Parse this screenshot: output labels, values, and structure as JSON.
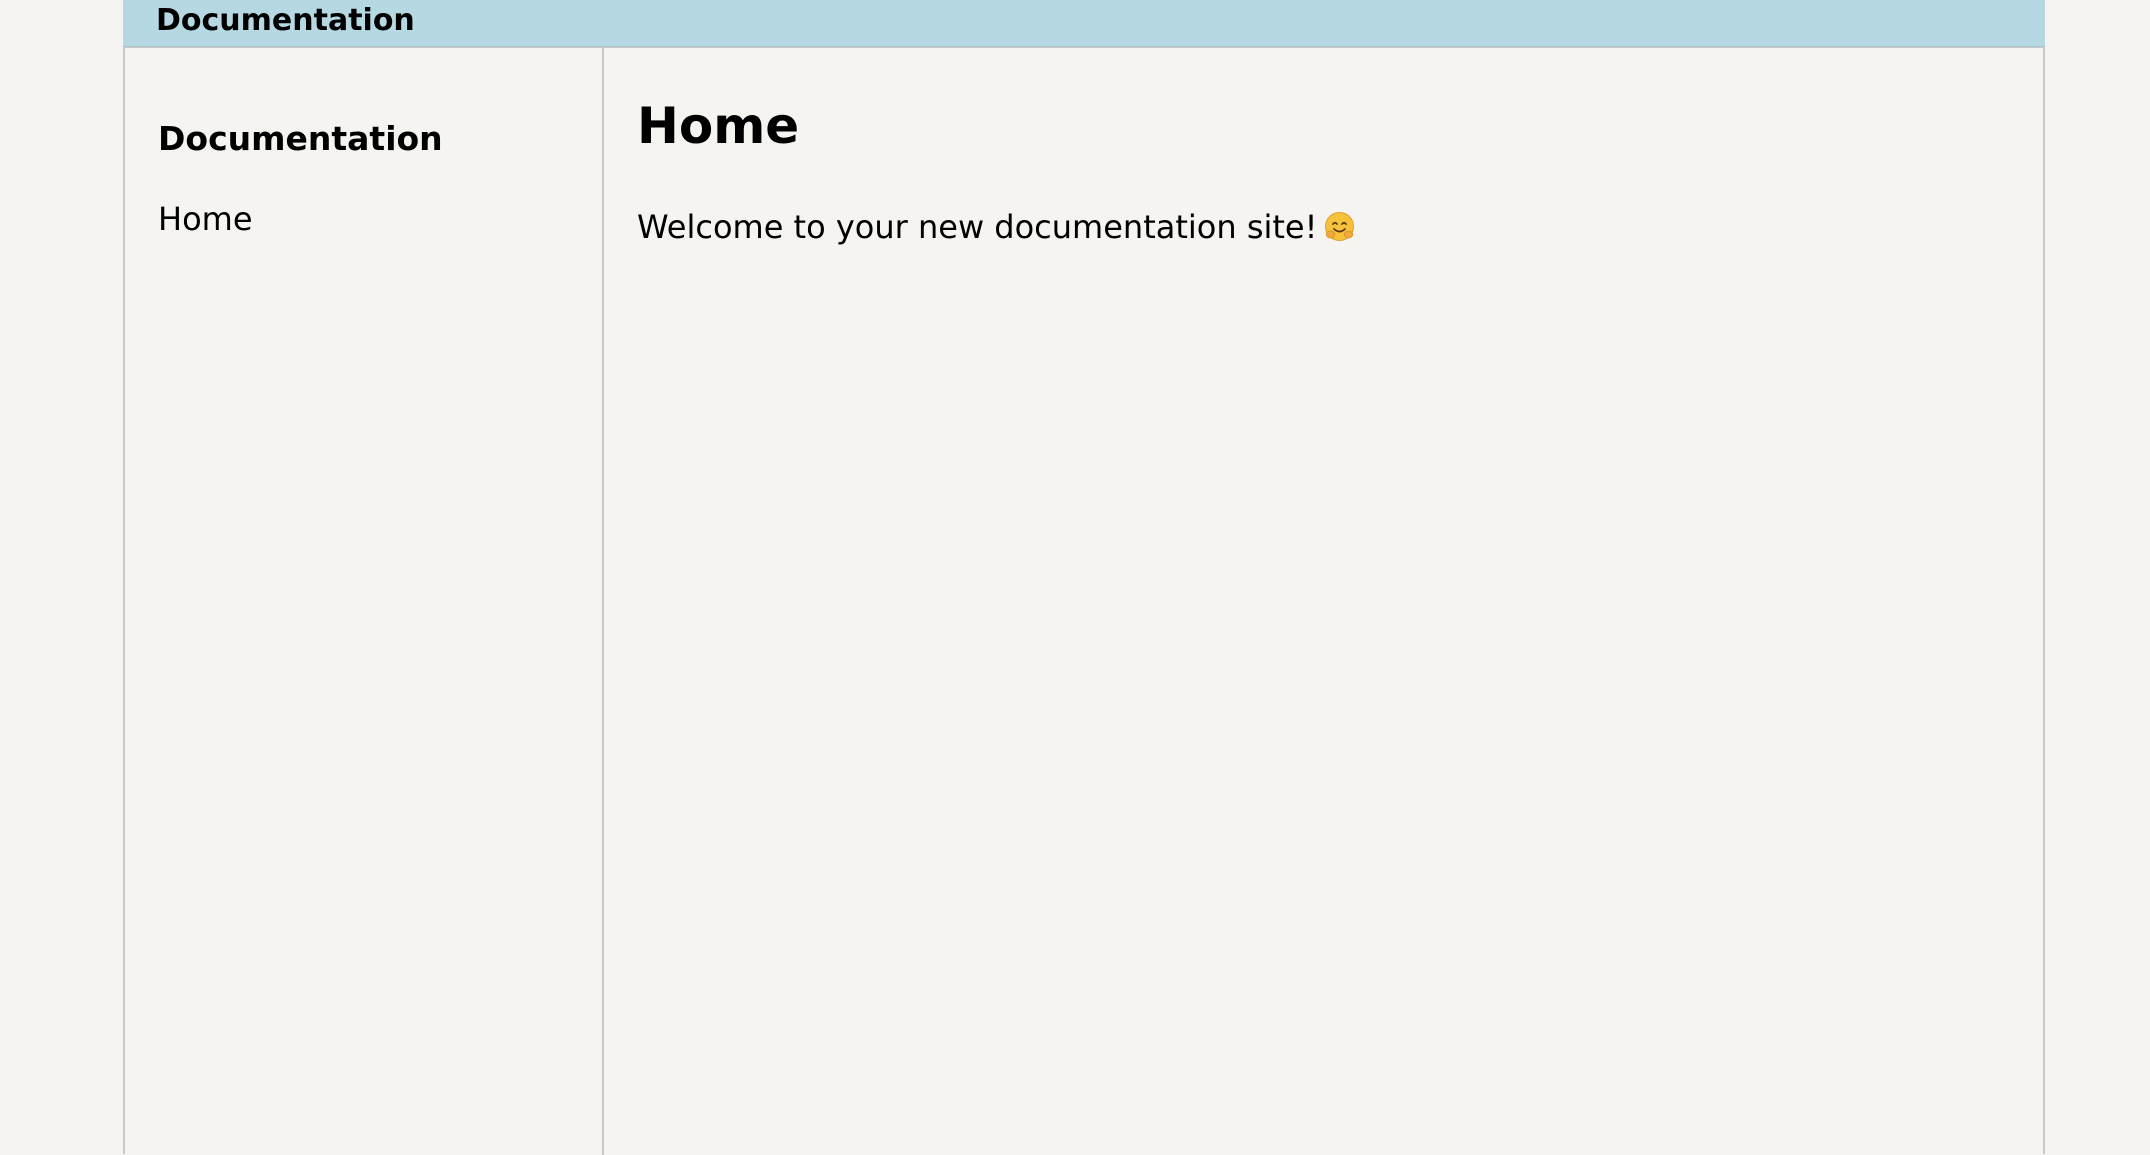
{
  "header": {
    "title": "Documentation"
  },
  "sidebar": {
    "title": "Documentation",
    "items": [
      {
        "label": "Home"
      }
    ]
  },
  "main": {
    "heading": "Home",
    "paragraph": "Welcome to your new documentation site!",
    "emoji_icon": "hugging-face-emoji"
  },
  "colors": {
    "header_bg": "#b5d8e3",
    "page_bg": "#f5f4f1",
    "border": "#c9c9c6"
  }
}
